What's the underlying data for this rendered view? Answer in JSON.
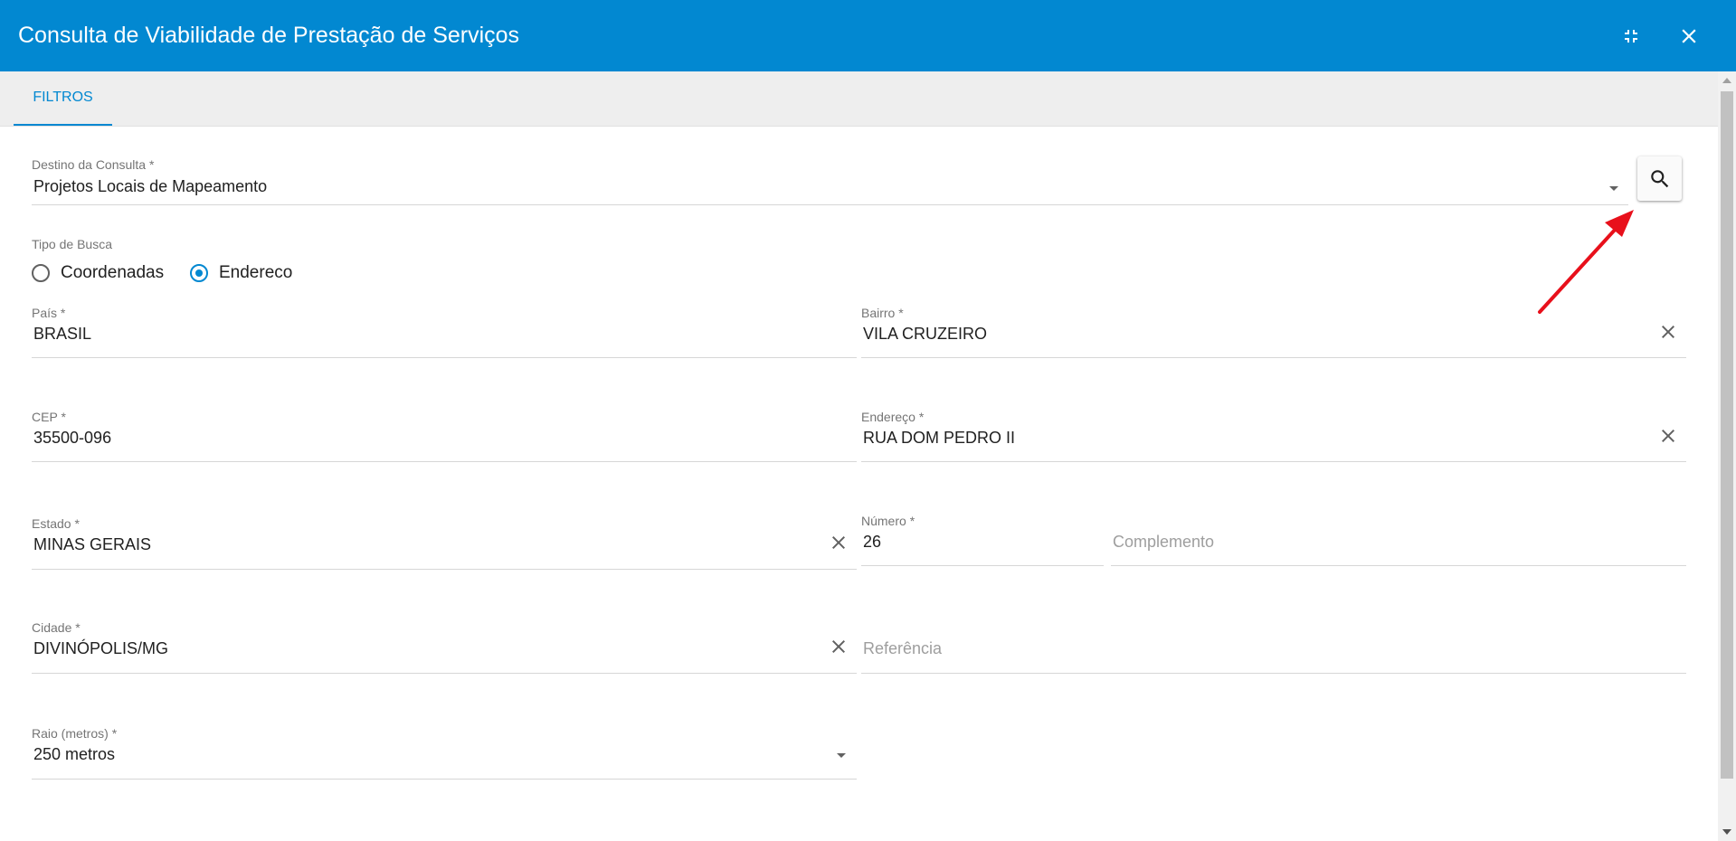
{
  "dialog": {
    "title": "Consulta de Viabilidade de Prestação de Serviços"
  },
  "header_icons": {
    "minimize": "fullscreen-exit-icon",
    "close": "close-icon"
  },
  "tabs": [
    {
      "label": "FILTROS",
      "active": true
    }
  ],
  "form": {
    "destino": {
      "label": "Destino da Consulta",
      "required": "*",
      "value": "Projetos Locais de Mapeamento"
    },
    "tipo_busca": {
      "label": "Tipo de Busca",
      "options": [
        {
          "label": "Coordenadas",
          "selected": false
        },
        {
          "label": "Endereco",
          "selected": true
        }
      ]
    },
    "pais": {
      "label": "País",
      "required": "*",
      "value": "BRASIL"
    },
    "bairro": {
      "label": "Bairro",
      "required": "*",
      "value": "VILA CRUZEIRO"
    },
    "cep": {
      "label": "CEP",
      "required": "*",
      "value": "35500-096"
    },
    "endereco": {
      "label": "Endereço",
      "required": "*",
      "value": "RUA DOM PEDRO II"
    },
    "estado": {
      "label": "Estado",
      "required": "*",
      "value": "MINAS GERAIS"
    },
    "numero": {
      "label": "Número",
      "required": "*",
      "value": "26"
    },
    "complemento": {
      "placeholder": "Complemento"
    },
    "cidade": {
      "label": "Cidade",
      "required": "*",
      "value": "DIVINÓPOLIS/MG"
    },
    "referencia": {
      "placeholder": "Referência"
    },
    "raio": {
      "label": "Raio (metros)",
      "required": "*",
      "value": "250 metros"
    }
  },
  "colors": {
    "header": "#0288d1",
    "accent": "#0288d1",
    "annotation_arrow": "#e8101b"
  }
}
